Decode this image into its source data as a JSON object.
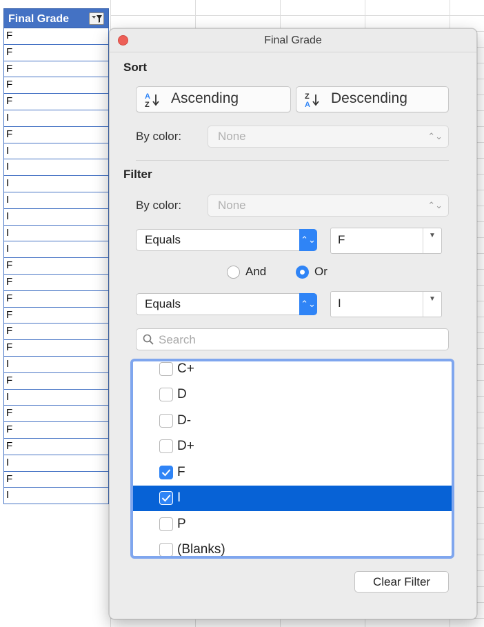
{
  "sheet": {
    "column_header": "Final Grade",
    "cells": [
      "F",
      "F",
      "F",
      "F",
      "F",
      "I",
      "F",
      "I",
      "I",
      "I",
      "I",
      "I",
      "I",
      "I",
      "F",
      "F",
      "F",
      "F",
      "F",
      "F",
      "I",
      "F",
      "I",
      "F",
      "F",
      "F",
      "I",
      "F",
      "I"
    ]
  },
  "dialog": {
    "title": "Final Grade",
    "sort": {
      "label": "Sort",
      "ascending_label": "Ascending",
      "descending_label": "Descending",
      "by_color_label": "By color:",
      "by_color_value": "None"
    },
    "filter": {
      "label": "Filter",
      "by_color_label": "By color:",
      "by_color_value": "None",
      "condition1": {
        "operator": "Equals",
        "value": "F"
      },
      "and_label": "And",
      "or_label": "Or",
      "selected_logic": "Or",
      "condition2": {
        "operator": "Equals",
        "value": "I"
      },
      "search_placeholder": "Search",
      "items": [
        {
          "label": "C+",
          "checked": false,
          "selected": false
        },
        {
          "label": "D",
          "checked": false,
          "selected": false
        },
        {
          "label": "D-",
          "checked": false,
          "selected": false
        },
        {
          "label": "D+",
          "checked": false,
          "selected": false
        },
        {
          "label": "F",
          "checked": true,
          "selected": false
        },
        {
          "label": "I",
          "checked": true,
          "selected": true
        },
        {
          "label": "P",
          "checked": false,
          "selected": false
        },
        {
          "label": "(Blanks)",
          "checked": false,
          "selected": false
        }
      ],
      "clear_label": "Clear Filter"
    }
  },
  "colors": {
    "header_blue": "#4472c4",
    "accent": "#2f84f6",
    "selection": "#0762d6",
    "close_red": "#ed5f57"
  },
  "icons": {
    "filter_button": "filter-funnel-icon",
    "close": "close-icon",
    "sort_asc": "sort-az-icon",
    "sort_desc": "sort-za-icon",
    "search": "search-icon"
  }
}
